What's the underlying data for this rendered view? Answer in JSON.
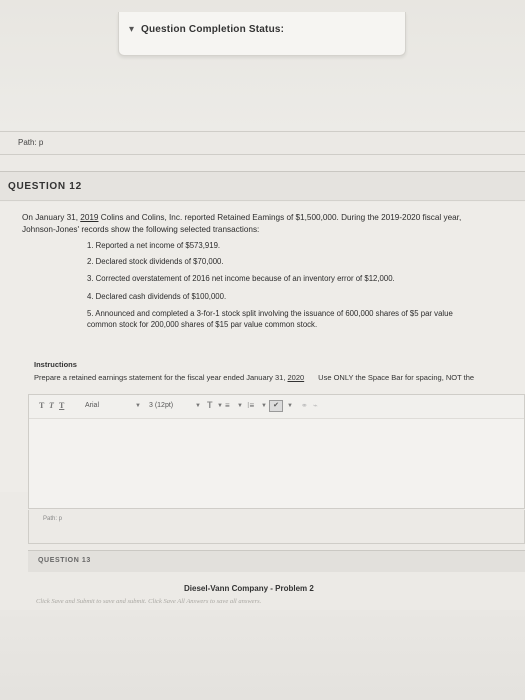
{
  "status_bar": {
    "toggle": "▾",
    "label": "Question Completion Status:"
  },
  "path_top": "Path: p",
  "question12": {
    "header": "QUESTION 12",
    "intro_line1_a": "On January 31, ",
    "intro_line1_year": "2019",
    "intro_line1_b": " Colins and Colins, Inc. reported Retained Eamings of $1,500,000. During the 2019-2020 fiscal year,",
    "intro_line2": "Johnson-Jones' records show the following selected transactions:",
    "transactions": [
      "1. Reported a net income of $573,919.",
      "2. Declared stock dividends of $70,000.",
      "3. Corrected overstatement of 2016 net income because of an inventory error of $12,000.",
      "4. Declared cash dividends of $100,000.",
      "5. Announced and completed a 3-for-1 stock split involving the issuance of 600,000 shares of $5 par value common stock for 200,000 shares of $15 par value common stock."
    ],
    "instructions_title": "Instructions",
    "instructions_text_a": "Prepare a retained earnings statement for the fiscal year ended January 31, ",
    "instructions_text_year": "2020",
    "instructions_text_b": "Use ONLY the Space Bar for spacing, NOT the",
    "editor": {
      "fmt_t1": "T",
      "fmt_t2": "T",
      "fmt_t3": "T",
      "font": "Arial",
      "size": "3 (12pt)",
      "text_color": "T",
      "list1": "≡",
      "list2": "⁝≡",
      "check": "✔",
      "path": "Path: p"
    }
  },
  "question13": {
    "header": "QUESTION 13",
    "problem_title": "Diesel-Vann Company  -  Problem 2",
    "footer_note": "Click Save and Submit to save and submit. Click Save All Answers to save all answers."
  }
}
